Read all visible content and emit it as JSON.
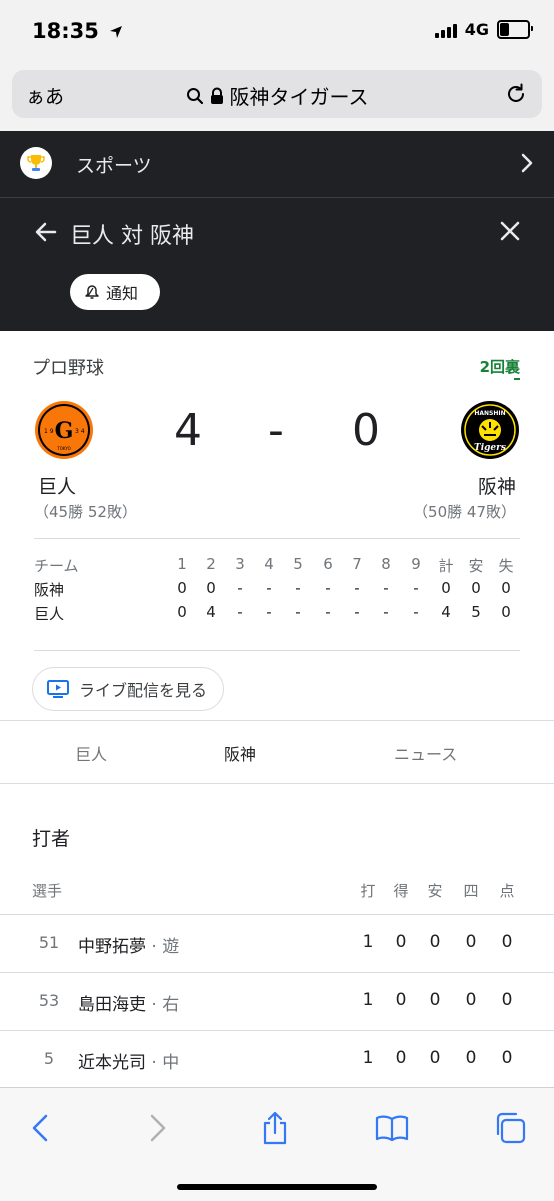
{
  "status_bar": {
    "time": "18:35",
    "network": "4G",
    "battery_level": 0.35
  },
  "address_bar": {
    "aa_label": "ぁあ",
    "url_text": "阪神タイガース"
  },
  "sports_header": {
    "label": "スポーツ"
  },
  "match_header": {
    "title": "巨人 対 阪神",
    "notify_label": "通知"
  },
  "scoreboard": {
    "league": "プロ野球",
    "inning_status": "2回裏",
    "home_team": {
      "name": "巨人",
      "record": "（45勝 52敗）",
      "score": "4",
      "logo_text": "1934 TOKYO"
    },
    "away_team": {
      "name": "阪神",
      "record": "（50勝 47敗）",
      "score": "0",
      "logo_text": "HANSHIN Tigers"
    },
    "dash": "-"
  },
  "line_score": {
    "header": [
      "チーム",
      "1",
      "2",
      "3",
      "4",
      "5",
      "6",
      "7",
      "8",
      "9",
      "計",
      "安",
      "失"
    ],
    "rows": [
      [
        "阪神",
        "0",
        "0",
        "-",
        "-",
        "-",
        "-",
        "-",
        "-",
        "-",
        "0",
        "0",
        "0"
      ],
      [
        "巨人",
        "0",
        "4",
        "-",
        "-",
        "-",
        "-",
        "-",
        "-",
        "-",
        "4",
        "5",
        "0"
      ]
    ]
  },
  "live_button": {
    "label": "ライブ配信を見る"
  },
  "tabs": [
    {
      "label": "巨人",
      "active": false
    },
    {
      "label": "阪神",
      "active": true
    },
    {
      "label": "ニュース",
      "active": false
    }
  ],
  "batters": {
    "title": "打者",
    "header": {
      "player": "選手",
      "cols": [
        "打",
        "得",
        "安",
        "四",
        "点"
      ]
    },
    "rows": [
      {
        "number": "51",
        "name": "中野拓夢",
        "position": " · 遊",
        "stats": [
          "1",
          "0",
          "0",
          "0",
          "0"
        ]
      },
      {
        "number": "53",
        "name": "島田海吏",
        "position": " · 右",
        "stats": [
          "1",
          "0",
          "0",
          "0",
          "0"
        ]
      },
      {
        "number": "5",
        "name": "近本光司",
        "position": " · 中",
        "stats": [
          "1",
          "0",
          "0",
          "0",
          "0"
        ]
      }
    ]
  },
  "colors": {
    "accent_green": "#188038",
    "dark_header": "#202124",
    "ios_blue": "#3478f6",
    "giants_orange": "#f97709",
    "tigers_yellow": "#ffe100"
  },
  "toolbar": {
    "icons": [
      "back-icon",
      "forward-icon",
      "share-icon",
      "bookmarks-icon",
      "tabs-icon"
    ]
  }
}
